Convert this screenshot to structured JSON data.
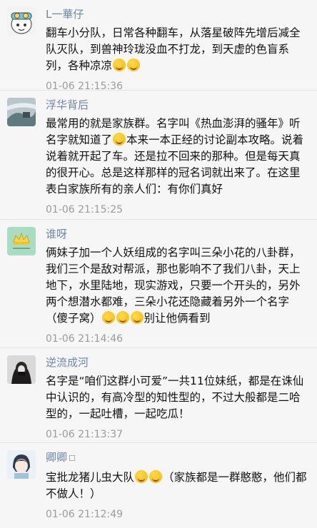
{
  "comments": [
    {
      "name": "L一華仔",
      "text_a": "翻车小分队，日常各种翻车，从落星破阵先增后减全队灭队，到兽神玲珑没血不打龙，到天虚的色盲系列，各种凉凉",
      "emoji_a": [
        "laugh-cry-emoji",
        "laugh-cry-emoji"
      ],
      "time": "01-06 21:15:36"
    },
    {
      "name": "浮华背后",
      "text_a": "最常用的就是家族群。名字叫《热血澎湃的骚年》听名字就知道了",
      "emoji_a": [
        "grin-emoji"
      ],
      "text_b": "本来一本正经的讨论副本攻略。说着说着就开起了车。还是拉不回来的那种。但是每天真的很开心。总是这样那样的冠名词就出来了。在这里表白家族所有的亲人们：有你们真好",
      "time": "01-06 21:15:25"
    },
    {
      "name": "谁呀",
      "text_a": "俩妹子加一个人妖组成的名字叫三朵小花的八卦群，我们三个是敌对帮派，那也影响不了我们八卦，天上地下，水里陆地，现实游戏，只要一个开头的，另外两个想潜水都难，三朵小花还隐藏着另外一个名字（傻子窝）",
      "emoji_a": [
        "thinking-emoji",
        "thinking-emoji",
        "thinking-emoji"
      ],
      "text_b": "别让他俩看到",
      "time": "01-06 21:14:46"
    },
    {
      "name": "逆流成河",
      "text_a": "名字是“咱们这群小可爱”一共11位妹纸，都是在诛仙中认识的，有高冷型的知性型的，不过大般都是二哈型的，一起吐槽，一起吃瓜！",
      "time": "01-06 21:13:37"
    },
    {
      "name": "卿卿",
      "name_suffix": "☐",
      "text_a": "宝批龙猪儿虫大队",
      "emoji_a": [
        "laugh-cry-emoji",
        "laugh-cry-emoji"
      ],
      "text_b": "（家族都是一群憨憨，他们都不做人！）",
      "time": "01-06 21:12:49"
    }
  ]
}
